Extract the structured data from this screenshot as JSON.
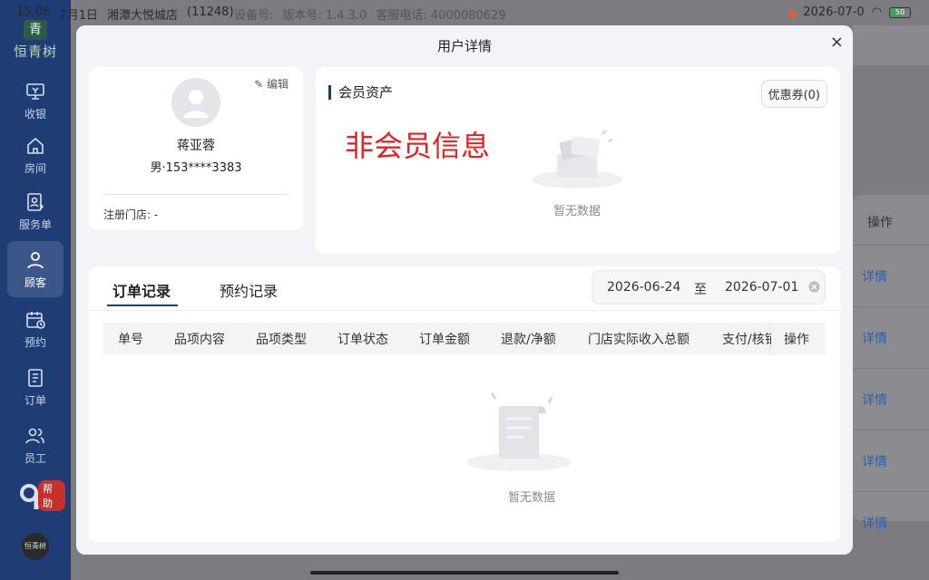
{
  "status_bar": {
    "time": "15:06",
    "date": "7月1日",
    "store": "湘潭大悦城店",
    "store_code": "(11248)",
    "device_label": "设备号:",
    "version": "版本号: 1.4.3.0",
    "hotline": "客服电话: 4000080629",
    "datetime_right": "2026-07-0",
    "battery": "50"
  },
  "sidebar": {
    "logo_badge": "青",
    "logo_name": "恒青树",
    "items": [
      {
        "label": "收银",
        "icon": "cashier-icon"
      },
      {
        "label": "房间",
        "icon": "home-icon"
      },
      {
        "label": "服务单",
        "icon": "service-order-icon"
      },
      {
        "label": "顾客",
        "icon": "customer-icon",
        "active": true
      },
      {
        "label": "预约",
        "icon": "calendar-icon"
      },
      {
        "label": "订单",
        "icon": "order-icon"
      },
      {
        "label": "员工",
        "icon": "staff-icon"
      }
    ],
    "help_label": "帮助",
    "bottom_avatar_text": "恒青树"
  },
  "background": {
    "column_header": "操作",
    "row_action": "详情",
    "rows": [
      "详情",
      "详情",
      "详情",
      "详情",
      "详情"
    ]
  },
  "modal": {
    "title": "用户详情",
    "close": "×",
    "user": {
      "edit_label": "编辑",
      "name": "蒋亚蓉",
      "gender_phone": "男·153****3383",
      "store_label": "注册门店: -"
    },
    "assets": {
      "title": "会员资产",
      "coupon_button": "优惠券(0)",
      "non_member_text": "非会员信息",
      "empty_text": "暂无数据"
    },
    "orders": {
      "tabs": [
        "订单记录",
        "预约记录"
      ],
      "date_start": "2026-06-24",
      "date_sep": "至",
      "date_end": "2026-07-01",
      "columns": [
        "单号",
        "品项内容",
        "品项类型",
        "订单状态",
        "订单金额",
        "退款/净额",
        "门店实际收入总额",
        "支付/核销",
        "操作"
      ],
      "empty_text": "暂无数据"
    }
  },
  "colors": {
    "sidebar": "#1f3c74",
    "accent": "#1f3c74",
    "non_member": "#e32222",
    "link": "#2d5fa8"
  }
}
